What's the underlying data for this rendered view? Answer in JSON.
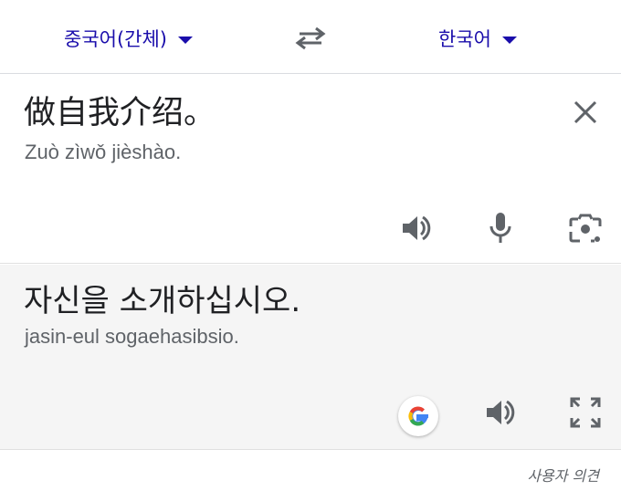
{
  "language_bar": {
    "source_language": "중국어(간체)",
    "target_language": "한국어",
    "swap_icon": "swap-arrows-icon"
  },
  "source": {
    "text": "做自我介绍。",
    "romanization": "Zuò zìwǒ jièshào.",
    "icons": [
      "close-icon",
      "speaker-icon",
      "microphone-icon",
      "camera-lens-icon"
    ]
  },
  "translation": {
    "text": "자신을 소개하십시오.",
    "romanization": "jasin-eul sogaehasibsio.",
    "icons": [
      "google-logo-icon",
      "speaker-icon",
      "fullscreen-icon"
    ]
  },
  "footer": {
    "feedback_label": "사용자 의견"
  },
  "colors": {
    "language_link": "#1a0dab",
    "icon": "#5f6368",
    "translation_background": "#f5f5f5"
  }
}
